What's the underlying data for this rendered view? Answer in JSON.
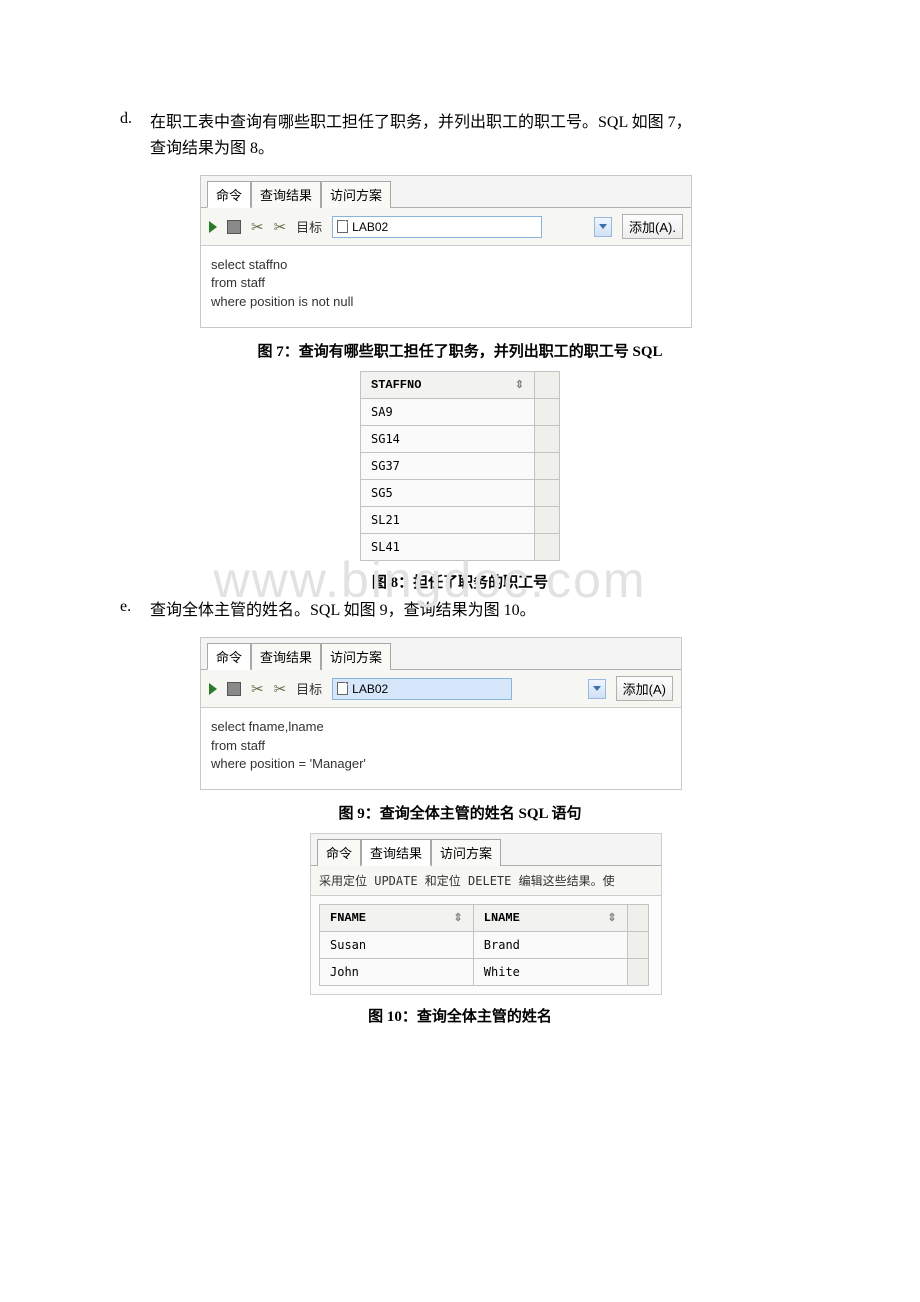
{
  "item_d": {
    "marker": "d.",
    "text_line1": "在职工表中查询有哪些职工担任了职务，并列出职工的职工号。SQL 如图 7，",
    "text_line2": "查询结果为图 8。"
  },
  "panel7": {
    "tabs": {
      "cmd": "命令",
      "result": "查询结果",
      "plan": "访问方案"
    },
    "toolbar": {
      "target_label": "目标",
      "target_value": "LAB02",
      "add_label": "添加(A)."
    },
    "sql": {
      "l1": "select staffno",
      "l2": "from staff",
      "l3": "where position is not null"
    }
  },
  "caption7": {
    "prefix": "图 7：",
    "text": "查询有哪些职工担任了职务，并列出职工的职工号 ",
    "suffix": "SQL"
  },
  "table8": {
    "header": "STAFFNO",
    "rows": [
      "SA9",
      "SG14",
      "SG37",
      "SG5",
      "SL21",
      "SL41"
    ]
  },
  "caption8": {
    "prefix": "图 8：",
    "text": "担任了职务的职工号"
  },
  "watermark": "www.bingdoc.com",
  "item_e": {
    "marker": "e.",
    "text": "查询全体主管的姓名。SQL 如图 9，查询结果为图 10。"
  },
  "panel9": {
    "tabs": {
      "cmd": "命令",
      "result": "查询结果",
      "plan": "访问方案"
    },
    "toolbar": {
      "target_label": "目标",
      "target_value": "LAB02",
      "add_label": "添加(A)"
    },
    "sql": {
      "l1": "select fname,lname",
      "l2": "from staff",
      "l3": "where position = 'Manager'"
    }
  },
  "caption9": {
    "prefix": "图 9：",
    "text": "查询全体主管的姓名 ",
    "suffix": "SQL 语句"
  },
  "panel10": {
    "tabs": {
      "cmd": "命令",
      "result": "查询结果",
      "plan": "访问方案"
    },
    "hint": "采用定位 UPDATE 和定位 DELETE 编辑这些结果。使",
    "headers": {
      "c1": "FNAME",
      "c2": "LNAME"
    },
    "rows": [
      {
        "c1": "Susan",
        "c2": "Brand"
      },
      {
        "c1": "John",
        "c2": "White"
      }
    ]
  },
  "caption10": {
    "prefix": "图 10：",
    "text": "查询全体主管的姓名"
  }
}
